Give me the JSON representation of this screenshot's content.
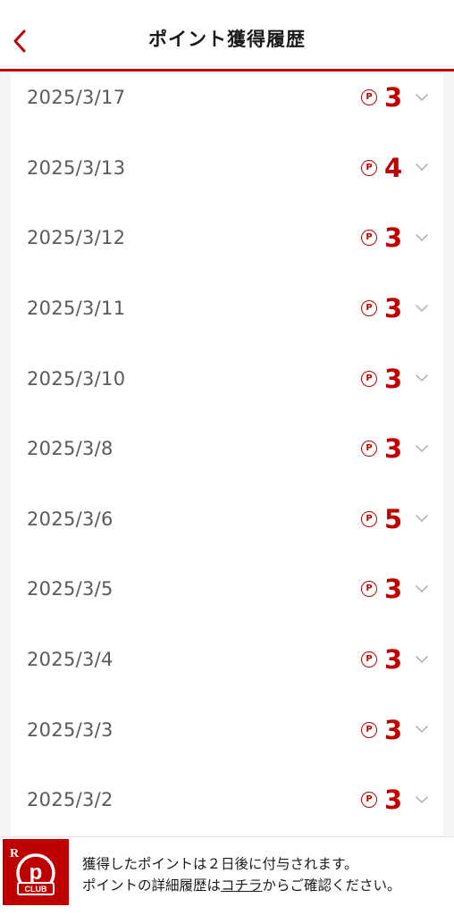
{
  "header": {
    "title": "ポイント獲得履歴",
    "back_icon": "chevron-left-icon"
  },
  "history": [
    {
      "date": "2025/3/17",
      "points": "3"
    },
    {
      "date": "2025/3/13",
      "points": "4"
    },
    {
      "date": "2025/3/12",
      "points": "3"
    },
    {
      "date": "2025/3/11",
      "points": "3"
    },
    {
      "date": "2025/3/10",
      "points": "3"
    },
    {
      "date": "2025/3/8",
      "points": "3"
    },
    {
      "date": "2025/3/6",
      "points": "5"
    },
    {
      "date": "2025/3/5",
      "points": "3"
    },
    {
      "date": "2025/3/4",
      "points": "3"
    },
    {
      "date": "2025/3/3",
      "points": "3"
    },
    {
      "date": "2025/3/2",
      "points": "3"
    }
  ],
  "point_icon_glyph": "P",
  "footer": {
    "logo_letter": "R",
    "logo_badge": "CLUB",
    "logo_mark": "p",
    "line1": "獲得したポイントは２日後に付与されます。",
    "line2_prefix": "ポイントの詳細履歴は",
    "link_text": "コチラ",
    "line2_suffix": "からご確認ください。"
  },
  "colors": {
    "accent": "#bf0000",
    "date_text": "#5a5a5a",
    "background": "#f4f4f4"
  }
}
